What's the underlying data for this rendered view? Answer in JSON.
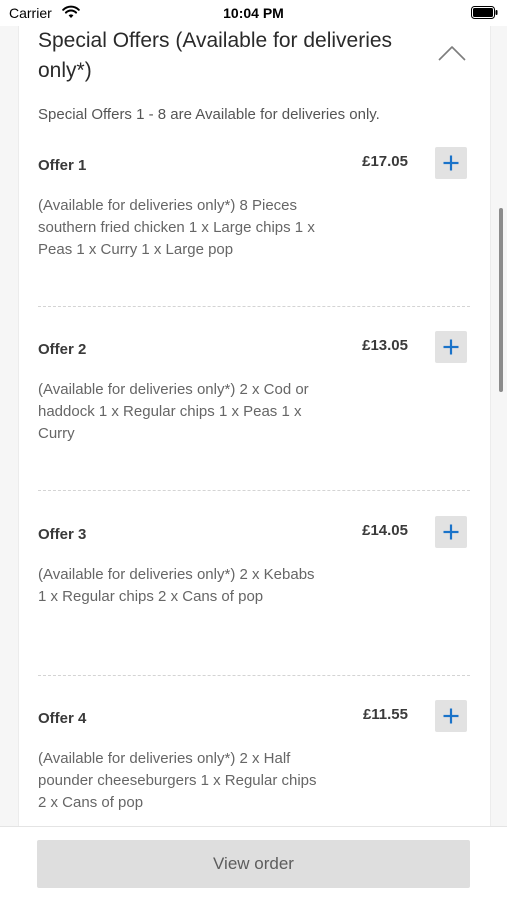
{
  "status_bar": {
    "carrier": "Carrier",
    "time": "10:04 PM",
    "wifi_icon": "wifi-icon",
    "battery_icon": "battery-icon"
  },
  "section": {
    "title": "Special Offers (Available for deliveries only*)",
    "collapse_icon": "chevron-up-icon",
    "note": "Special Offers 1 - 8 are Available for deliveries only."
  },
  "offers": [
    {
      "title": "Offer 1",
      "price": "£17.05",
      "description": "(Available for deliveries only*) 8 Pieces southern fried chicken 1 x Large chips 1 x Peas 1 x Curry 1 x Large pop"
    },
    {
      "title": "Offer 2",
      "price": "£13.05",
      "description": "(Available for deliveries only*) 2 x Cod or haddock 1 x Regular chips 1 x Peas 1 x Curry"
    },
    {
      "title": "Offer 3",
      "price": "£14.05",
      "description": "(Available for deliveries only*) 2 x Kebabs 1 x Regular chips 2 x Cans of pop"
    },
    {
      "title": "Offer 4",
      "price": "£11.55",
      "description": "(Available for deliveries only*) 2 x Half pounder cheeseburgers 1 x Regular chips 2 x Cans of pop"
    }
  ],
  "add_icon": "plus-icon",
  "bottom_bar": {
    "view_order_label": "View order"
  },
  "colors": {
    "accent": "#1a73c9",
    "button_bg": "#e2e2e2"
  }
}
